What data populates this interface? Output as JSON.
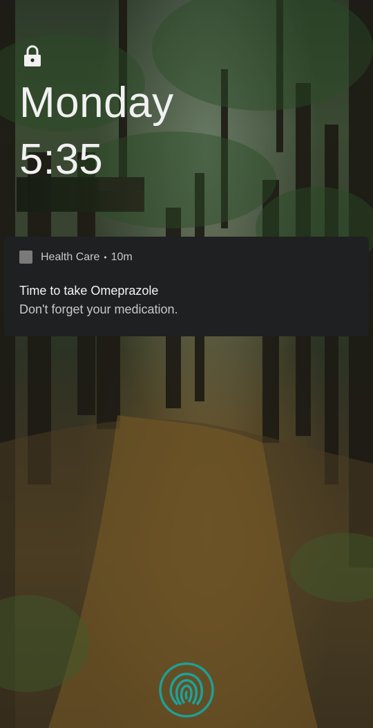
{
  "lockscreen": {
    "day": "Monday",
    "time": "5:35",
    "status_icon": "lock-icon"
  },
  "notification": {
    "app_name": "Health Care",
    "separator": "•",
    "age": "10m",
    "title": "Time to take Omeprazole",
    "body": "Don't forget your medication."
  },
  "footer": {
    "icon": "fingerprint-icon",
    "accent_color": "#1ba39c"
  }
}
